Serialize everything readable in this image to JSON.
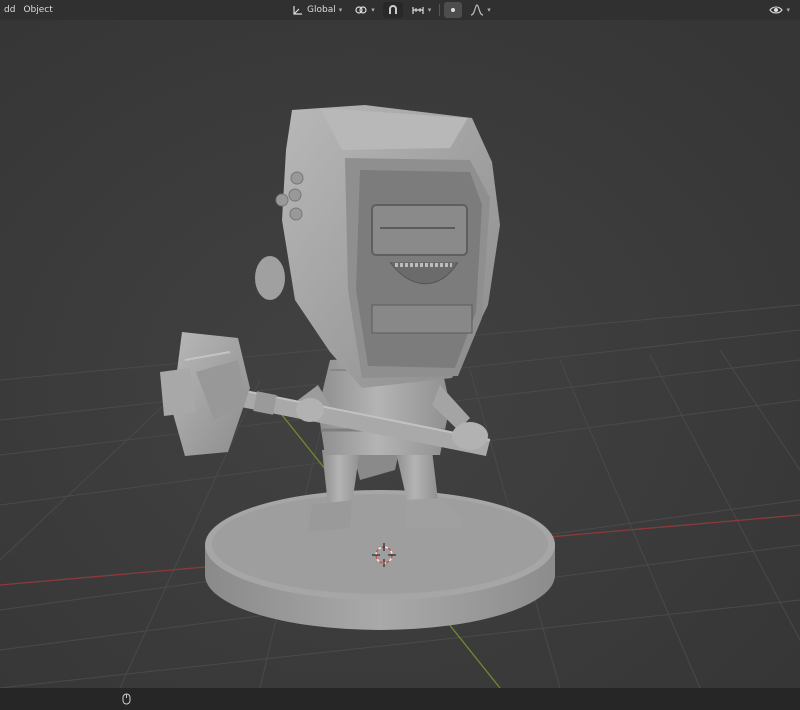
{
  "header": {
    "menu": [
      {
        "id": "add",
        "label": "dd"
      },
      {
        "id": "object",
        "label": "Object"
      }
    ],
    "orientation": {
      "label": "Global",
      "icon": "transform-orientation-icon"
    },
    "pivot_icon": "pivot-point-icon",
    "snap_icon": "snap-icon",
    "snap_target_icon": "snap-increment-icon",
    "proportional_icon": "proportional-editing-icon",
    "falloff_icon": "falloff-curve-icon",
    "view_icon": "visibility-icon"
  },
  "viewport": {
    "grid_color": "#4a4a4a",
    "x_axis_color": "#8b3a3a",
    "y_axis_color": "#6e8b2e",
    "model_color": "#a8a8a8",
    "cursor_icon": "3d-cursor-icon"
  },
  "footer": {
    "mouse_icon": "mouse-icon"
  }
}
